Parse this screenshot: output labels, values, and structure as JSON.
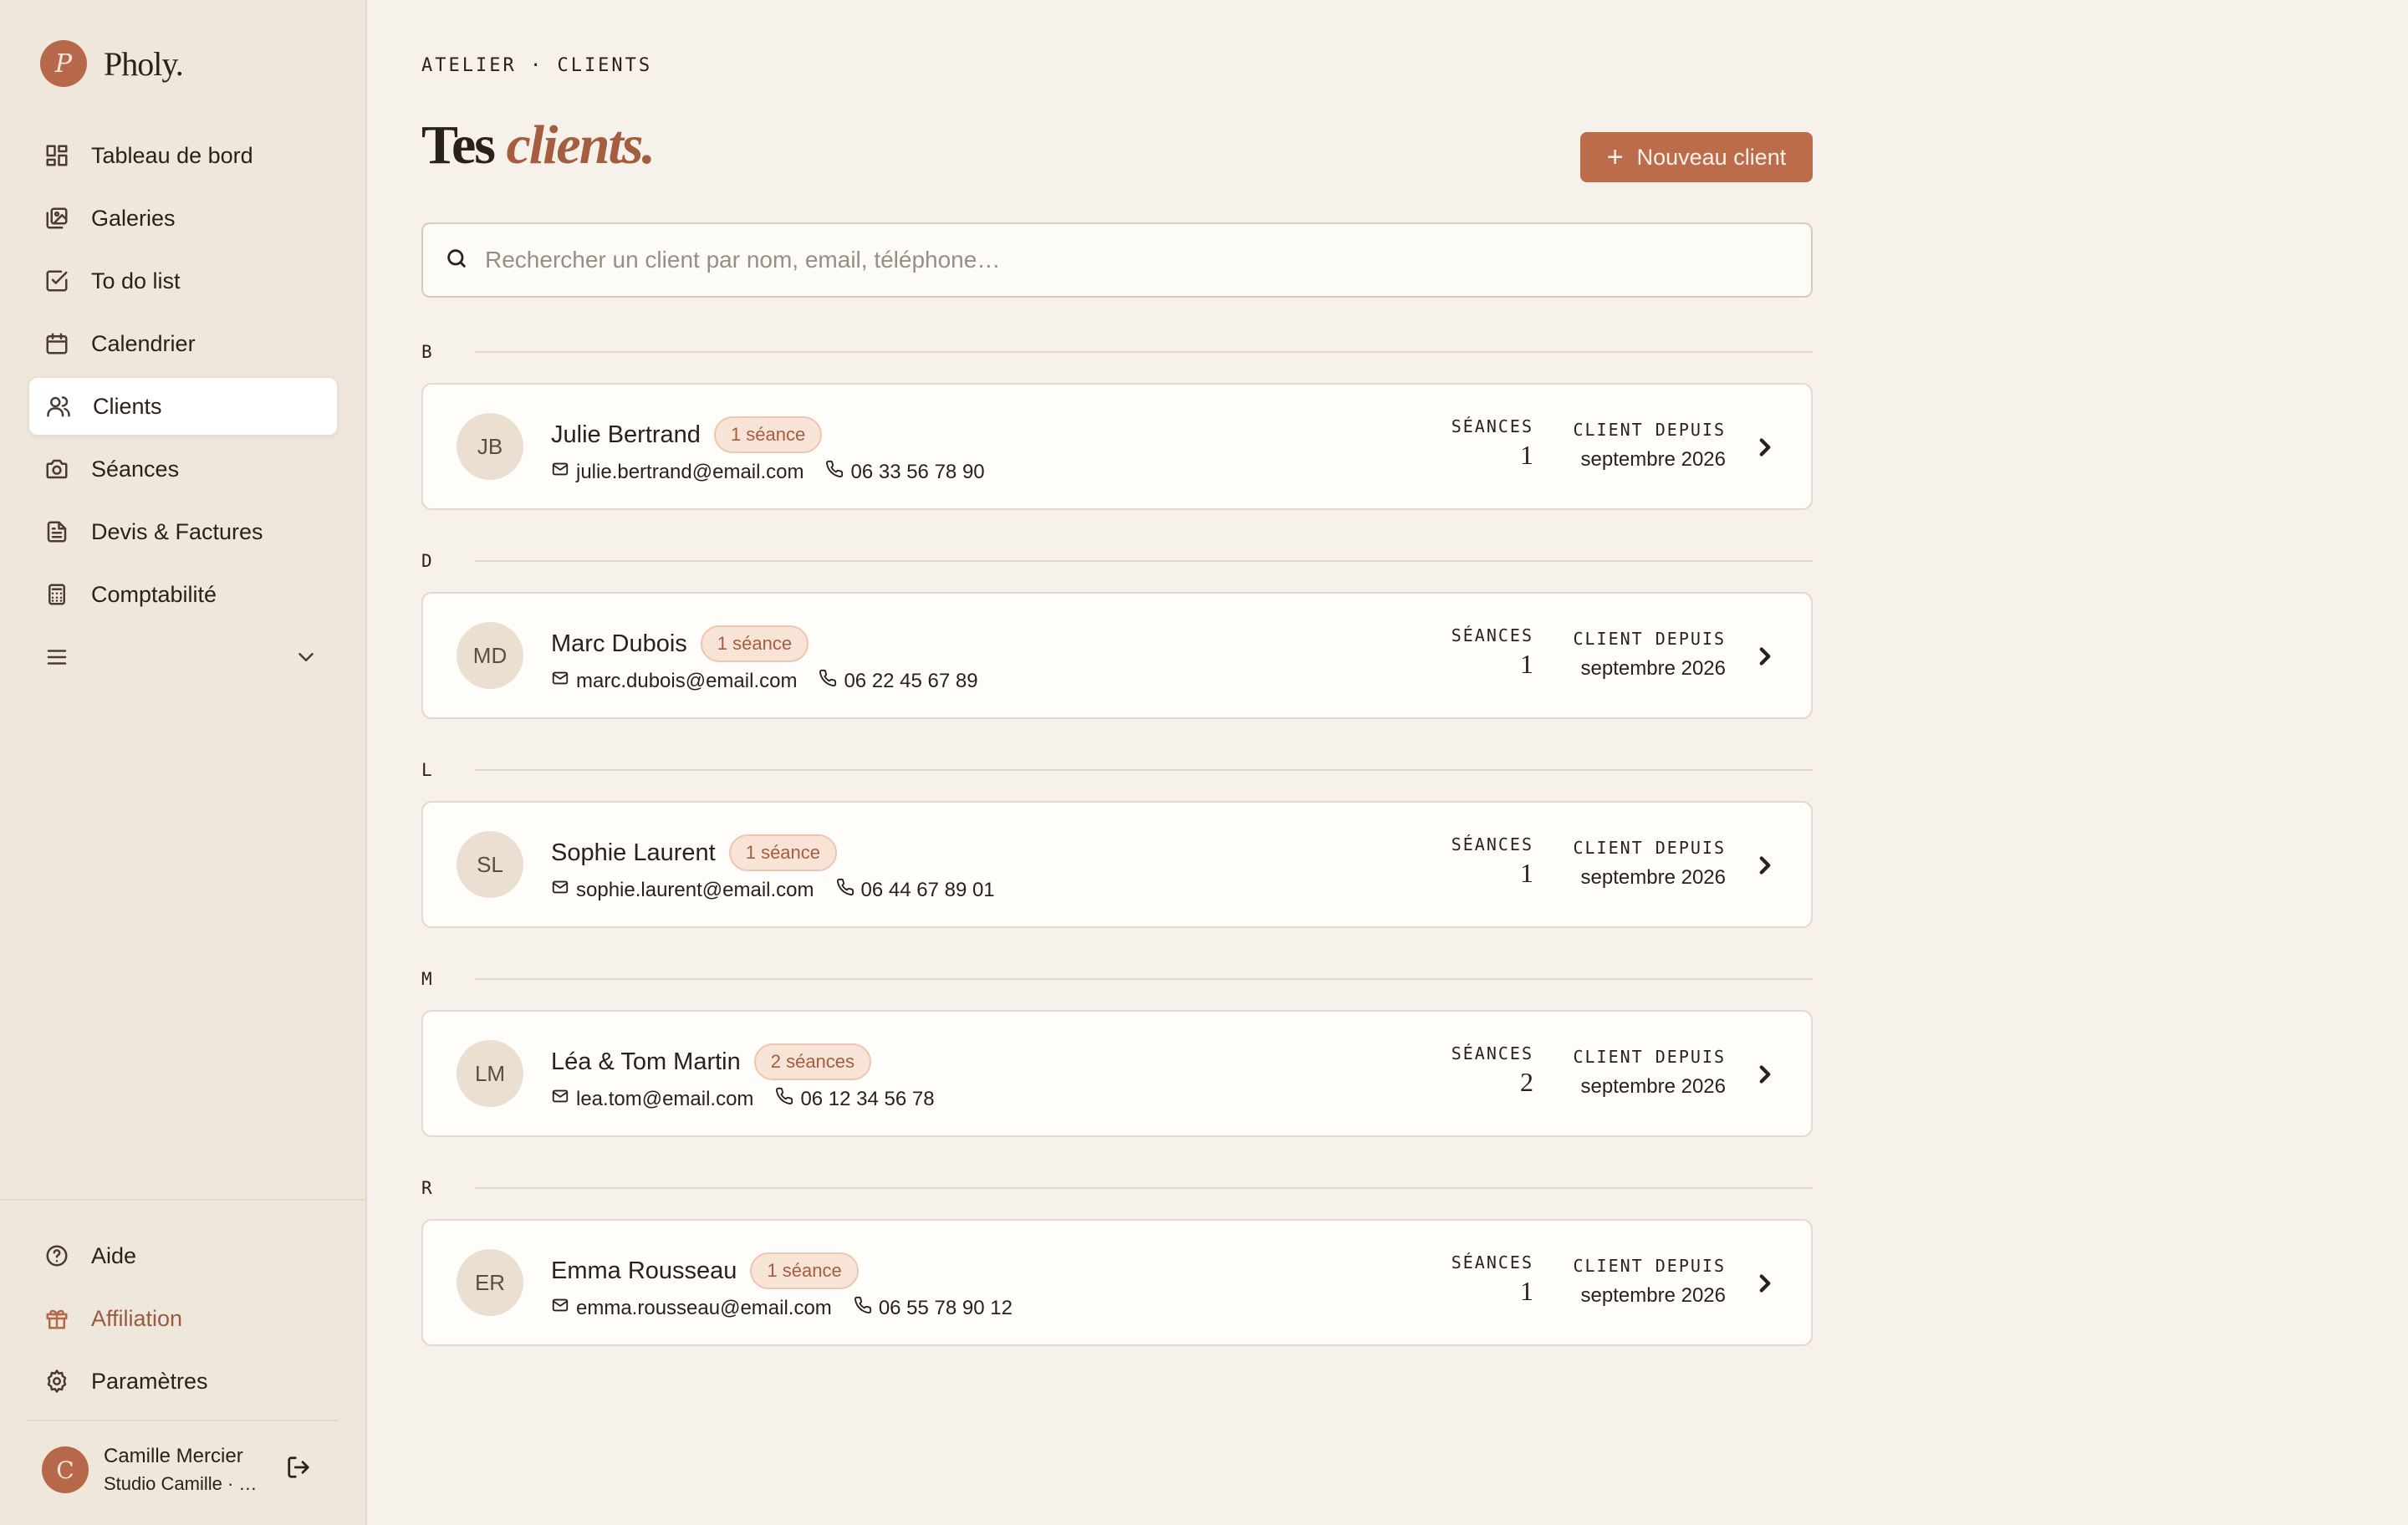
{
  "brand": {
    "logo_letter": "P",
    "name": "Pholy."
  },
  "sidebar": {
    "items": [
      {
        "label": "Tableau de bord",
        "icon": "dashboard-icon"
      },
      {
        "label": "Galeries",
        "icon": "gallery-icon"
      },
      {
        "label": "To do list",
        "icon": "checkbox-icon"
      },
      {
        "label": "Calendrier",
        "icon": "calendar-icon"
      },
      {
        "label": "Clients",
        "icon": "users-icon",
        "active": true
      },
      {
        "label": "Séances",
        "icon": "camera-icon"
      },
      {
        "label": "Devis & Factures",
        "icon": "document-icon"
      },
      {
        "label": "Comptabilité",
        "icon": "calculator-icon"
      }
    ],
    "more_icon": "menu-icon",
    "bottom_items": [
      {
        "label": "Aide",
        "icon": "help-icon"
      },
      {
        "label": "Affiliation",
        "icon": "gift-icon"
      },
      {
        "label": "Paramètres",
        "icon": "gear-icon"
      }
    ],
    "user": {
      "initial": "C",
      "name": "Camille Mercier",
      "studio": "Studio Camille · …"
    }
  },
  "header": {
    "breadcrumb": "ATELIER · CLIENTS",
    "title_prefix": "Tes",
    "title_emphasis": "clients.",
    "new_button": "Nouveau client"
  },
  "search": {
    "placeholder": "Rechercher un client par nom, email, téléphone…",
    "value": ""
  },
  "labels": {
    "seances": "SÉANCES",
    "client_since": "CLIENT DEPUIS"
  },
  "groups": [
    {
      "letter": "B",
      "client": {
        "initials": "JB",
        "name": "Julie Bertrand",
        "badge": "1 séance",
        "email": "julie.bertrand@email.com",
        "phone": "06 33 56 78 90",
        "seances": "1",
        "since": "septembre 2026"
      }
    },
    {
      "letter": "D",
      "client": {
        "initials": "MD",
        "name": "Marc Dubois",
        "badge": "1 séance",
        "email": "marc.dubois@email.com",
        "phone": "06 22 45 67 89",
        "seances": "1",
        "since": "septembre 2026"
      }
    },
    {
      "letter": "L",
      "client": {
        "initials": "SL",
        "name": "Sophie Laurent",
        "badge": "1 séance",
        "email": "sophie.laurent@email.com",
        "phone": "06 44 67 89 01",
        "seances": "1",
        "since": "septembre 2026"
      }
    },
    {
      "letter": "M",
      "client": {
        "initials": "LM",
        "name": "Léa & Tom Martin",
        "badge": "2 séances",
        "email": "lea.tom@email.com",
        "phone": "06 12 34 56 78",
        "seances": "2",
        "since": "septembre 2026"
      }
    },
    {
      "letter": "R",
      "client": {
        "initials": "ER",
        "name": "Emma Rousseau",
        "badge": "1 séance",
        "email": "emma.rousseau@email.com",
        "phone": "06 55 78 90 12",
        "seances": "1",
        "since": "septembre 2026"
      }
    }
  ]
}
